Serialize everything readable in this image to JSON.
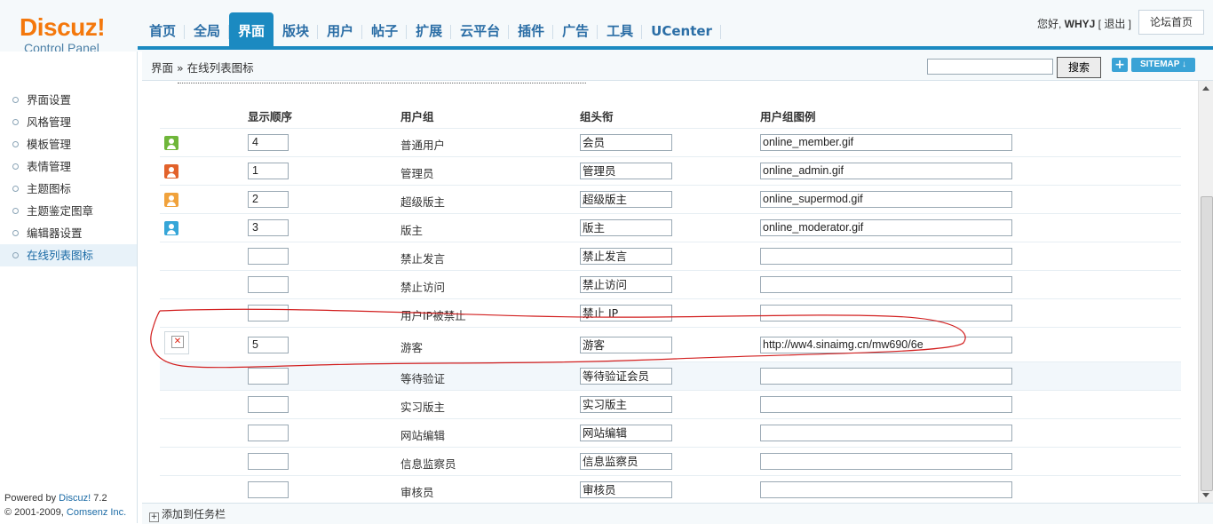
{
  "header": {
    "logo_text": "Discuz!",
    "logo_sub": "Control Panel",
    "nav": [
      "首页",
      "全局",
      "界面",
      "版块",
      "用户",
      "帖子",
      "扩展",
      "云平台",
      "插件",
      "广告",
      "工具",
      "UCenter"
    ],
    "active_tab": "界面",
    "greeting": "您好,",
    "username": "WHYJ",
    "logout": "[ 退出 ]",
    "home_button": "论坛首页"
  },
  "breadcrumb": {
    "section": "界面",
    "sep": "»",
    "page": "在线列表图标"
  },
  "search": {
    "placeholder": "",
    "button": "搜索"
  },
  "sitemap": {
    "plus": "+",
    "label": "SITEMAP"
  },
  "sidebar": {
    "items": [
      "界面设置",
      "风格管理",
      "模板管理",
      "表情管理",
      "主题图标",
      "主题鉴定图章",
      "编辑器设置",
      "在线列表图标"
    ],
    "active": "在线列表图标"
  },
  "footer": {
    "powered_prefix": "Powered by",
    "powered_brand": "Discuz!",
    "version": "7.2",
    "copyright_prefix": "© 2001-2009,",
    "company": "Comsenz Inc."
  },
  "table": {
    "headers": [
      "显示顺序",
      "用户组",
      "组头衔",
      "用户组图例"
    ],
    "rows": [
      {
        "icon": "member-icon",
        "order": "4",
        "group": "普通用户",
        "title": "会员",
        "image": "online_member.gif"
      },
      {
        "icon": "admin-icon",
        "order": "1",
        "group": "管理员",
        "title": "管理员",
        "image": "online_admin.gif"
      },
      {
        "icon": "supermod-icon",
        "order": "2",
        "group": "超级版主",
        "title": "超级版主",
        "image": "online_supermod.gif"
      },
      {
        "icon": "moderator-icon",
        "order": "3",
        "group": "版主",
        "title": "版主",
        "image": "online_moderator.gif"
      },
      {
        "icon": "",
        "order": "",
        "group": "禁止发言",
        "title": "禁止发言",
        "image": ""
      },
      {
        "icon": "",
        "order": "",
        "group": "禁止访问",
        "title": "禁止访问",
        "image": ""
      },
      {
        "icon": "",
        "order": "",
        "group": "用户IP被禁止",
        "title": "禁止 IP",
        "image": ""
      },
      {
        "icon": "broken-image-icon",
        "order": "5",
        "group": "游客",
        "title": "游客",
        "image": "http://ww4.sinaimg.cn/mw690/6e"
      },
      {
        "icon": "",
        "order": "",
        "group": "等待验证",
        "title": "等待验证会员",
        "image": ""
      },
      {
        "icon": "",
        "order": "",
        "group": "实习版主",
        "title": "实习版主",
        "image": ""
      },
      {
        "icon": "",
        "order": "",
        "group": "网站编辑",
        "title": "网站编辑",
        "image": ""
      },
      {
        "icon": "",
        "order": "",
        "group": "信息监察员",
        "title": "信息监察员",
        "image": ""
      },
      {
        "icon": "",
        "order": "",
        "group": "审核员",
        "title": "审核员",
        "image": ""
      }
    ]
  },
  "taskbar": {
    "add_label": "添加到任务栏"
  },
  "colors": {
    "accent": "#1b8ac1",
    "logo": "#f4780c",
    "annotation": "#d21f1f",
    "member": "#6fb63a",
    "admin": "#e2622b",
    "supermod": "#f0a23c",
    "moderator": "#36a6d8"
  }
}
